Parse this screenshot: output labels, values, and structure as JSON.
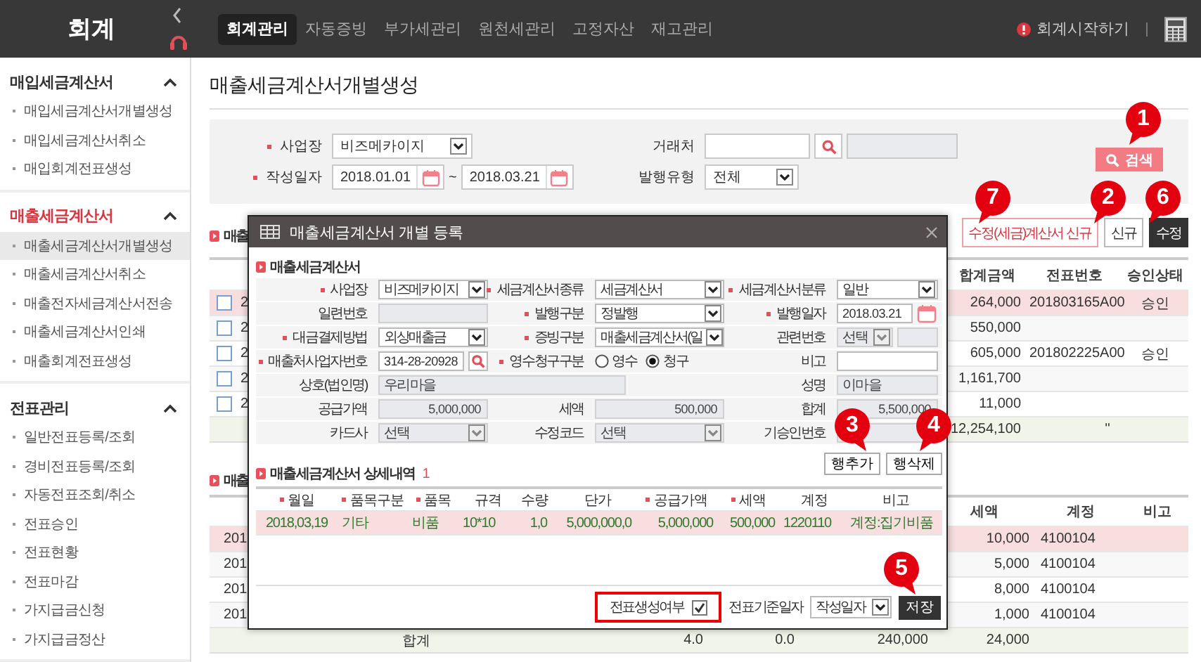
{
  "topbar": {
    "logo": "회계",
    "menu": [
      {
        "label": "회계관리",
        "selected": true
      },
      {
        "label": "자동증빙",
        "selected": false
      },
      {
        "label": "부가세관리",
        "selected": false
      },
      {
        "label": "원천세관리",
        "selected": false
      },
      {
        "label": "고정자산",
        "selected": false
      },
      {
        "label": "재고관리",
        "selected": false
      }
    ],
    "start_link": "회계시작하기"
  },
  "sidebar": [
    {
      "title": "매입세금계산서",
      "current": false,
      "expanded": true,
      "items": [
        {
          "label": "매입세금계산서개별생성",
          "selected": false
        },
        {
          "label": "매입세금계산서취소",
          "selected": false
        },
        {
          "label": "매입회계전표생성",
          "selected": false
        }
      ]
    },
    {
      "title": "매출세금계산서",
      "current": true,
      "expanded": true,
      "items": [
        {
          "label": "매출세금계산서개별생성",
          "selected": true
        },
        {
          "label": "매출세금계산서취소",
          "selected": false
        },
        {
          "label": "매출전자세금계산서전송",
          "selected": false
        },
        {
          "label": "매출세금계산서인쇄",
          "selected": false
        },
        {
          "label": "매출회계전표생성",
          "selected": false
        }
      ]
    },
    {
      "title": "전표관리",
      "current": false,
      "expanded": true,
      "items": [
        {
          "label": "일반전표등록/조회",
          "selected": false
        },
        {
          "label": "경비전표등록/조회",
          "selected": false
        },
        {
          "label": "자동전표조회/취소",
          "selected": false
        },
        {
          "label": "전표승인",
          "selected": false
        },
        {
          "label": "전표현황",
          "selected": false
        },
        {
          "label": "전표마감",
          "selected": false
        },
        {
          "label": "가지급금신청",
          "selected": false
        },
        {
          "label": "가지급금정산",
          "selected": false
        }
      ]
    }
  ],
  "page_title": "매출세금계산서개별생성",
  "search": {
    "business": {
      "label": "사업장",
      "required": true,
      "value": "비즈메카이지"
    },
    "partner": {
      "label": "거래처",
      "required": false
    },
    "date": {
      "label": "작성일자",
      "required": true,
      "from": "2018.01.01",
      "separator": "~",
      "to": "2018.03.21"
    },
    "issue_type": {
      "label": "발행유형",
      "required": false,
      "value": "전체"
    },
    "search_button": "검색"
  },
  "actions": [
    {
      "label": "수정(세금)계산서 신규",
      "kind": "outline"
    },
    {
      "label": "신규",
      "kind": "plain"
    },
    {
      "label": "수정",
      "kind": "dark"
    }
  ],
  "invoice_list": {
    "title": "매출",
    "columns": [
      "합계금액",
      "전표번호",
      "승인상태"
    ],
    "rows": [
      {
        "selected": true,
        "checked": false,
        "date": "2",
        "total": "264,000",
        "voucher": "201803165A00",
        "status": "승인"
      },
      {
        "selected": false,
        "checked": false,
        "date": "2",
        "total": "550,000"
      },
      {
        "selected": false,
        "checked": false,
        "date": "2",
        "total": "605,000",
        "voucher": "201802225A00",
        "status": "승인"
      },
      {
        "selected": false,
        "checked": false,
        "date": "2",
        "total": "1,161,700"
      },
      {
        "selected": false,
        "checked": false,
        "date": "2",
        "total": "11,000"
      }
    ],
    "summary": {
      "total": "12,254,100",
      "note": "''"
    }
  },
  "detail_list": {
    "title": "매출",
    "columns": [
      "세액",
      "계정",
      "비고"
    ],
    "rows": [
      {
        "selected": true,
        "date": "201",
        "tax": "10,000",
        "account": "4100104"
      },
      {
        "selected": false,
        "date": "201",
        "tax": "5,000",
        "account": "4100104"
      },
      {
        "selected": false,
        "date": "201",
        "tax": "8,000",
        "account": "4100104"
      },
      {
        "selected": false,
        "date": "201",
        "tax": "1,000",
        "account": "4100104"
      }
    ],
    "summary": {
      "label": "합계",
      "values": [
        "4.0",
        "0.0",
        "240,000",
        "24,000"
      ]
    }
  },
  "modal": {
    "title": "매출세금계산서 개별 등록",
    "section": "매출세금계산서",
    "form": [
      [
        {
          "label": "사업장",
          "required": true,
          "kind": "select",
          "value": "비즈메카이지",
          "disabled": false
        },
        {
          "label": "세금계산서종류",
          "required": true,
          "kind": "select",
          "value": "세금계산서",
          "disabled": false
        },
        {
          "label": "세금계산서분류",
          "required": true,
          "kind": "select",
          "value": "일반",
          "disabled": false
        }
      ],
      [
        {
          "label": "일련번호",
          "required": false,
          "kind": "input",
          "disabled": true
        },
        {
          "label": "발행구분",
          "required": true,
          "kind": "select",
          "value": "정발행",
          "disabled": false
        },
        {
          "label": "발행일자",
          "required": true,
          "kind": "date",
          "value": "2018.03.21",
          "disabled": false
        }
      ],
      [
        {
          "label": "대금결제방법",
          "required": true,
          "kind": "select",
          "value": "외상매출금",
          "disabled": false
        },
        {
          "label": "증빙구분",
          "required": true,
          "kind": "select",
          "value": "매출세금계산서(일",
          "disabled": false
        },
        {
          "label": "관련번호",
          "required": false,
          "kind": "select_input",
          "value": "선택",
          "disabled": true
        }
      ],
      [
        {
          "label": "매출처사업자번호",
          "required": true,
          "kind": "lookup",
          "value": "314-28-20928",
          "disabled": false
        },
        {
          "label": "영수청구구분",
          "required": true,
          "kind": "radio",
          "options": [
            {
              "label": "영수",
              "selected": false
            },
            {
              "label": "청구",
              "selected": true
            }
          ]
        },
        {
          "label": "비고",
          "required": false,
          "kind": "input",
          "disabled": false
        }
      ],
      [
        {
          "label": "상호(법인명)",
          "required": false,
          "kind": "wide_input",
          "value": "우리마을",
          "disabled": true
        },
        {
          "label": "성명",
          "required": false,
          "kind": "input",
          "value": "이마을",
          "disabled": true
        }
      ],
      [
        {
          "label": "공급가액",
          "required": false,
          "kind": "amount",
          "value": "5,000,000",
          "disabled": true
        },
        {
          "label": "세액",
          "required": false,
          "kind": "amount",
          "value": "500,000",
          "disabled": true
        },
        {
          "label": "합계",
          "required": false,
          "kind": "amount",
          "value": "5,500,000",
          "disabled": true
        }
      ],
      [
        {
          "label": "카드사",
          "required": false,
          "kind": "select",
          "value": "선택",
          "disabled": true
        },
        {
          "label": "수정코드",
          "required": false,
          "kind": "select",
          "value": "선택",
          "disabled": true
        },
        {
          "label": "기승인번호",
          "required": false,
          "kind": "input",
          "disabled": true
        }
      ]
    ],
    "row_buttons": [
      "행추가",
      "행삭제"
    ],
    "detail": {
      "title": "매출세금계산서 상세내역",
      "count": "1",
      "columns": [
        {
          "label": "월일",
          "required": true
        },
        {
          "label": "품목구분",
          "required": true
        },
        {
          "label": "품목",
          "required": true
        },
        {
          "label": "규격",
          "required": false
        },
        {
          "label": "수량",
          "required": false
        },
        {
          "label": "단가",
          "required": false
        },
        {
          "label": "공급가액",
          "required": true
        },
        {
          "label": "세액",
          "required": true
        },
        {
          "label": "계정",
          "required": false
        },
        {
          "label": "비고",
          "required": false
        }
      ],
      "rows": [
        {
          "selected": true,
          "cells": [
            "2018,03,19",
            "기타",
            "비품",
            "10*10",
            "1,0",
            "5,000,000,0",
            "5,000,000",
            "500,000",
            "1220110",
            "계정:집기비품"
          ]
        }
      ]
    },
    "footer": {
      "voucher_toggle": {
        "label": "전표생성여부",
        "checked": true,
        "highlighted": true
      },
      "date_basis": {
        "label": "전표기준일자",
        "value": "작성일자"
      },
      "save": "저장"
    }
  },
  "callouts": [
    {
      "label": "1"
    },
    {
      "label": "7"
    },
    {
      "label": "2"
    },
    {
      "label": "6"
    },
    {
      "label": "3"
    },
    {
      "label": "4"
    },
    {
      "label": "5"
    }
  ]
}
